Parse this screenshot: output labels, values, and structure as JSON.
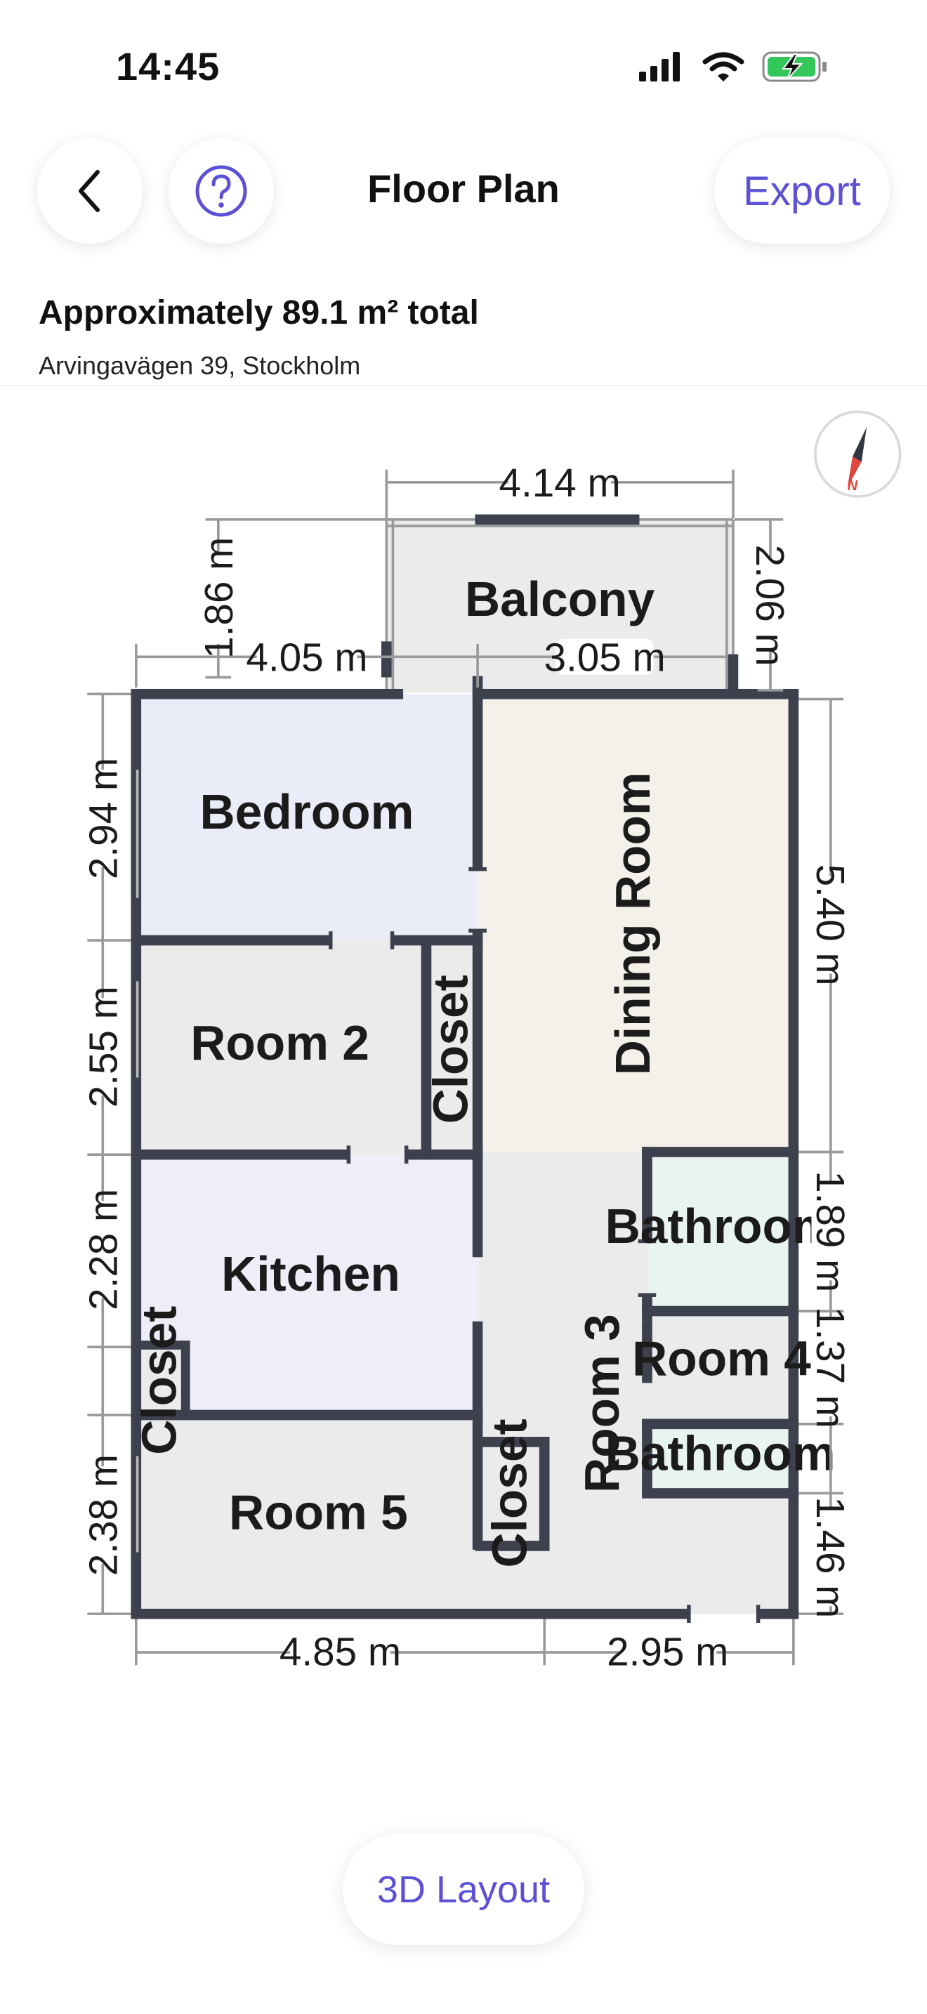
{
  "status": {
    "time": "14:45"
  },
  "header": {
    "title": "Floor Plan",
    "export_label": "Export"
  },
  "summary": {
    "area": "Approximately 89.1 m² total",
    "address": "Arvingavägen 39, Stockholm"
  },
  "rooms": {
    "balcony": "Balcony",
    "bedroom": "Bedroom",
    "room2": "Room 2",
    "closet_a": "Closet",
    "dining": "Dining Room",
    "kitchen": "Kitchen",
    "closet_b": "Closet",
    "room3": "Room 3",
    "bathroom_a": "Bathroom",
    "room4": "Room 4",
    "bathroom_b": "Bathroom",
    "room5": "Room 5",
    "closet_c": "Closet"
  },
  "dimensions": {
    "balcony_width": "4.14 m",
    "balcony_offset": "1.86 m",
    "balcony_depth": "2.06 m",
    "top_left": "4.05 m",
    "top_right": "3.05 m",
    "left_1": "2.94 m",
    "left_2": "2.55 m",
    "left_3": "2.28 m",
    "left_4": "2.38 m",
    "right_1": "5.40 m",
    "right_2": "1.89 m",
    "right_3": "1.37 m",
    "right_4": "1.46 m",
    "bottom_left": "4.85 m",
    "bottom_right": "2.95 m"
  },
  "footer": {
    "layout_button": "3D Layout"
  },
  "colors": {
    "accent": "#5b50d6",
    "wall": "#3d404d",
    "bedroom": "#eaecf7",
    "dining": "#f4f1ea",
    "kitchen": "#efedf8",
    "bathroom": "#e8f4f1",
    "neutral_room": "#ebebeb"
  }
}
